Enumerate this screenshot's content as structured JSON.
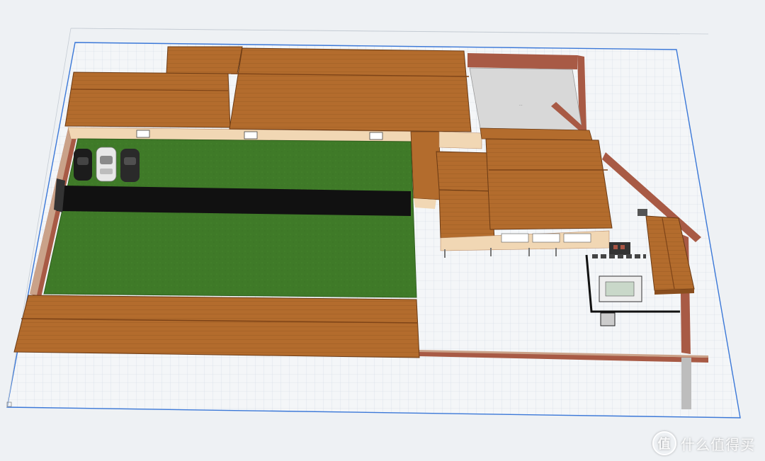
{
  "scene": {
    "description_tag": "3d-courtyard-model",
    "colors": {
      "background": "#eef1f4",
      "grid_line": "#c9d3de",
      "grid_border": "#3b78d8",
      "roof": "#b06a2c",
      "roof_dark": "#8a4e1e",
      "roof_edge": "#6b3a14",
      "wall": "#a85a45",
      "wall_top": "#caa289",
      "lawn": "#3f7a28",
      "lawn_dark": "#2f5f1d",
      "driveway": "#111111",
      "floor": "#d8d8d8",
      "plaster": "#f1d7b4"
    },
    "cars": [
      {
        "color": "#1c1c1c"
      },
      {
        "color": "#e8e8e8"
      },
      {
        "color": "#2a2a2a"
      }
    ]
  },
  "watermark": {
    "logo_glyph": "值",
    "text": "什么值得买"
  }
}
